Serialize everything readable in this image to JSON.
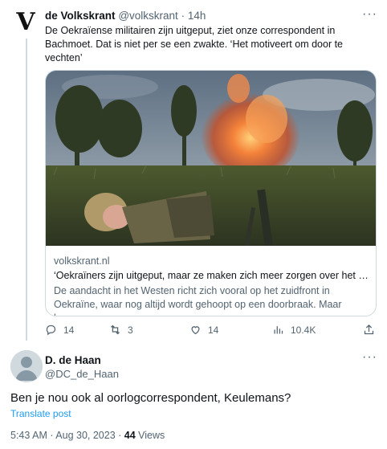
{
  "tweet": {
    "author_logo": "V",
    "author_name": "de Volkskrant",
    "author_handle": "@volkskrant",
    "separator": "·",
    "time": "14h",
    "text": "De Oekraïense militairen zijn uitgeput, ziet onze correspondent in Bachmoet. Dat is niet per se een zwakte. ‘Het motiveert om door te vechten’",
    "card": {
      "domain": "volkskrant.nl",
      "title": "‘Oekraïners zijn uitgeput, maar ze maken zich meer zorgen over het ui...",
      "description": "De aandacht in het Westen richt zich vooral op het zuidfront in Oekraïne, waar nog altijd wordt gehoopt op een doorbraak. Maar lang..."
    },
    "actions": {
      "replies": "14",
      "reposts": "3",
      "likes": "14",
      "views": "10.4K"
    }
  },
  "reply": {
    "author_name": "D. de Haan",
    "author_handle": "@DC_de_Haan",
    "text": "Ben je nou ook al oorlogcorrespondent, Keulemans?",
    "translate_label": "Translate post",
    "timestamp": "5:43 AM · Aug 30, 2023 · ",
    "views_count": "44",
    "views_label": " Views"
  },
  "icons": {
    "more": "more-horizontal-icon",
    "reply": "reply-icon",
    "repost": "repost-icon",
    "like": "heart-icon",
    "views": "views-icon",
    "share": "share-icon"
  },
  "colors": {
    "muted": "#536471",
    "link": "#1d9bf0",
    "border": "#cfd9de",
    "text": "#0f1419"
  }
}
